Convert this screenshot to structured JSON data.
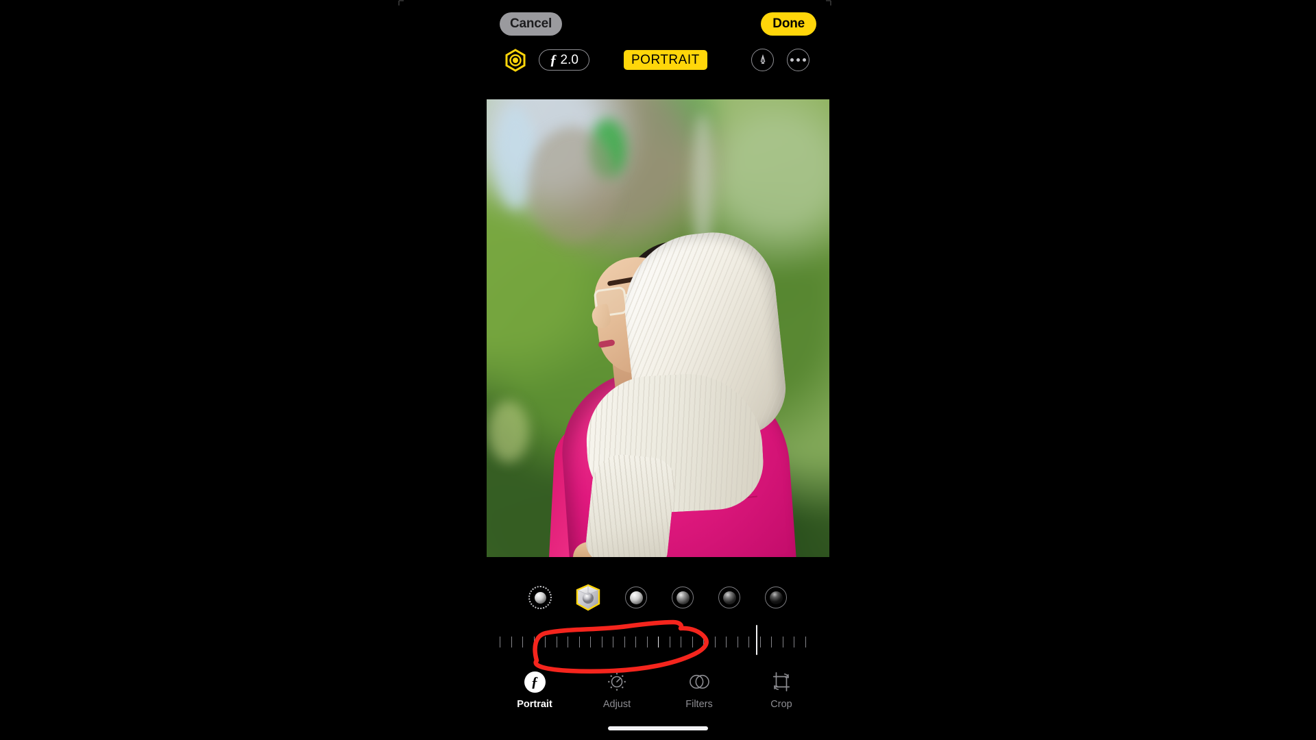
{
  "app": {
    "screen_name": "Photos Portrait Editor",
    "background_color": "#000000"
  },
  "topbar": {
    "cancel_label": "Cancel",
    "done_label": "Done",
    "cancel_bg": "#9a9a9e",
    "done_bg": "#ffd60a"
  },
  "toolrow": {
    "portrait_toggle_icon": "hexagon-aperture-icon",
    "aperture_f_glyph": "ƒ",
    "aperture_value": "2.0",
    "portrait_badge_label": "PORTRAIT",
    "portrait_badge_color": "#ffd60a",
    "markup_icon": "markup-pen-icon",
    "more_icon": "more-ellipsis-icon"
  },
  "photo": {
    "description": "Portrait photo of a woman in profile wearing a white pleated headscarf and a magenta pink jacket, with blurred green foliage background",
    "subject_clothing_color": "#e0197e",
    "scarf_color": "#f4f1e8"
  },
  "lighting_effects": {
    "selected_index": 1,
    "items": [
      {
        "name": "natural-light",
        "icon": "dotted-sphere-icon",
        "selected": false
      },
      {
        "name": "studio-light",
        "icon": "yellow-cube-icon",
        "selected": true
      },
      {
        "name": "contour-light",
        "icon": "ring-sphere-icon",
        "selected": false
      },
      {
        "name": "stage-light",
        "icon": "ring-sphere-dark-icon",
        "selected": false
      },
      {
        "name": "stage-light-mono",
        "icon": "ring-sphere-darker-icon",
        "selected": false
      },
      {
        "name": "high-key-light-mono",
        "icon": "ring-sphere-darkest-icon",
        "selected": false
      }
    ]
  },
  "depth_slider": {
    "name": "depth-intensity-slider",
    "tick_count": 28,
    "cursor_position_percent": 81,
    "annotation": {
      "type": "hand-drawn-ellipse",
      "color": "#f5251d",
      "note": "red freehand circle drawn around the depth slider"
    }
  },
  "bottom_tabs": {
    "active": "Portrait",
    "items": [
      {
        "label": "Portrait",
        "icon": "f-aperture-icon",
        "active": true
      },
      {
        "label": "Adjust",
        "icon": "brightness-dial-icon",
        "active": false
      },
      {
        "label": "Filters",
        "icon": "overlapping-circles-icon",
        "active": false
      },
      {
        "label": "Crop",
        "icon": "crop-rotate-icon",
        "active": false
      }
    ]
  },
  "system": {
    "home_indicator": "home-indicator-bar"
  }
}
